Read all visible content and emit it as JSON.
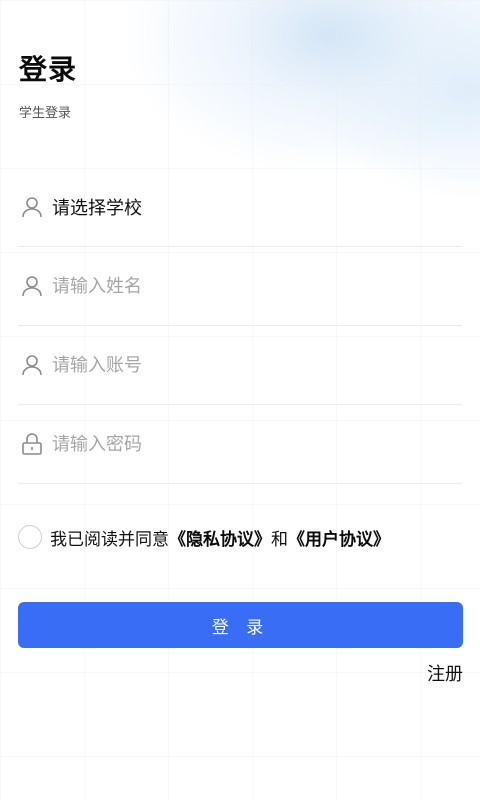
{
  "header": {
    "title": "登录",
    "subtitle": "学生登录"
  },
  "form": {
    "school": {
      "value": "请选择学校",
      "icon": "user-icon"
    },
    "name": {
      "placeholder": "请输入姓名",
      "value": "",
      "icon": "user-icon"
    },
    "account": {
      "placeholder": "请输入账号",
      "value": "",
      "icon": "user-icon"
    },
    "password": {
      "placeholder": "请输入密码",
      "value": "",
      "icon": "lock-icon"
    }
  },
  "agreement": {
    "prefix": "我已阅读并同意",
    "privacy_link": "《隐私协议》",
    "conjunction": "和",
    "user_link": "《用户协议》",
    "checked": false
  },
  "actions": {
    "login_label": "登 录",
    "register_label": "注册"
  },
  "colors": {
    "primary": "#3a6df5",
    "divider": "#ececec",
    "placeholder": "#a6a6a6"
  }
}
